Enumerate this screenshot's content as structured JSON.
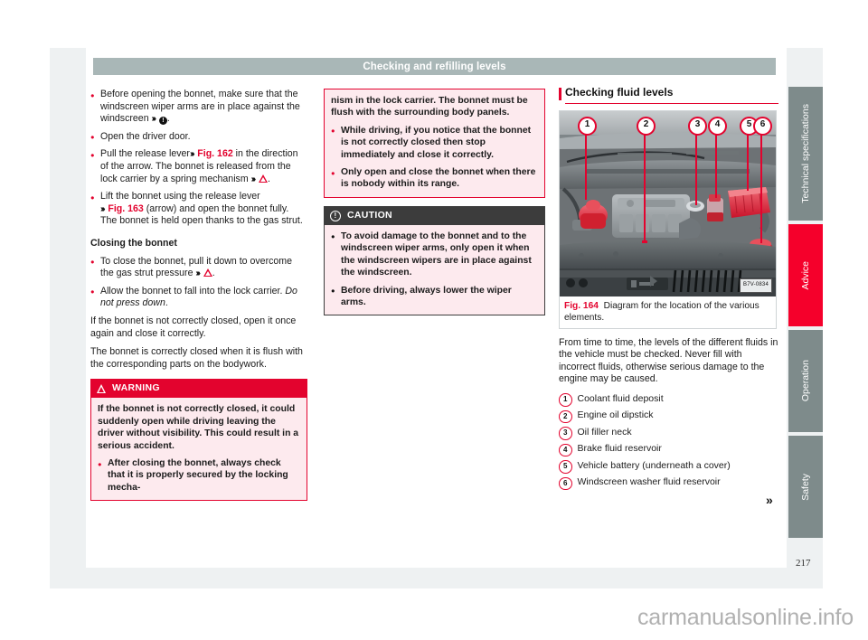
{
  "header": {
    "title": "Checking and refilling levels"
  },
  "page_number": "217",
  "watermark": "carmanualsonline.info",
  "column1": {
    "bullets_open": [
      {
        "pre": "Before opening the bonnet, make sure that the windscreen wiper arms are in place against the windscreen ",
        "ref": "",
        "post": "."
      },
      {
        "pre": "Open the driver door.",
        "ref": "",
        "post": ""
      },
      {
        "pre": "Pull the release lever",
        "ref": "Fig. 162",
        "post": " in the direction of the arrow. The bonnet is released from the lock carrier by a spring mechanism "
      },
      {
        "pre": "Lift the bonnet using the release lever ",
        "ref": "Fig. 163",
        "post": " (arrow) and open the bonnet fully. The bonnet is held open thanks to the gas strut."
      }
    ],
    "subheading": "Closing the bonnet",
    "bullets_close": [
      {
        "pre": "To close the bonnet, pull it down to overcome the gas strut pressure ",
        "post": "."
      },
      {
        "pre": "Allow the bonnet to fall into the lock carrier. ",
        "italic": "Do not press down",
        "post": "."
      }
    ],
    "para1": "If the bonnet is not correctly closed, open it once again and close it correctly.",
    "para2": "The bonnet is correctly closed when it is flush with the corresponding parts on the bodywork.",
    "warning": {
      "title": "WARNING",
      "body": "If the bonnet is not correctly closed, it could suddenly open while driving leaving the driver without visibility. This could result in a serious accident.",
      "bullet": "After closing the bonnet, always check that it is properly secured by the locking mecha-"
    }
  },
  "column2": {
    "continued": {
      "body": "nism in the lock carrier. The bonnet must be flush with the surrounding body panels.",
      "bullets": [
        "While driving, if you notice that the bonnet is not correctly closed then stop immediately and close it correctly.",
        "Only open and close the bonnet when there is nobody within its range."
      ]
    },
    "caution": {
      "title": "CAUTION",
      "bullets": [
        "To avoid damage to the bonnet and to the windscreen wiper arms, only open it when the windscreen wipers are in place against the windscreen.",
        "Before driving, always lower the wiper arms."
      ]
    }
  },
  "column3": {
    "section_title": "Checking fluid levels",
    "figure": {
      "number": "Fig. 164",
      "caption": "Diagram for the location of the various elements.",
      "photo_code": "B7V-0834",
      "callouts": [
        "1",
        "2",
        "3",
        "4",
        "5",
        "6"
      ]
    },
    "intro": "From time to time, the levels of the different fluids in the vehicle must be checked. Never fill with incorrect fluids, otherwise serious damage to the engine may be caused.",
    "legend": [
      {
        "num": "1",
        "label": "Coolant fluid deposit"
      },
      {
        "num": "2",
        "label": "Engine oil dipstick"
      },
      {
        "num": "3",
        "label": "Oil filler neck"
      },
      {
        "num": "4",
        "label": "Brake fluid reservoir"
      },
      {
        "num": "5",
        "label": "Vehicle battery (underneath a cover)"
      },
      {
        "num": "6",
        "label": "Windscreen washer fluid reservoir"
      }
    ],
    "continuation_arrow": "»"
  },
  "tabs": [
    {
      "label": "Technical specifications",
      "active": false
    },
    {
      "label": "Advice",
      "active": true
    },
    {
      "label": "Operation",
      "active": false
    },
    {
      "label": "Safety",
      "active": false
    }
  ],
  "colors": {
    "accent_red": "#e3032e",
    "tab_active": "#f5002b",
    "tab_inactive": "#7e8b8b",
    "header_bar": "#a9b7b7"
  }
}
